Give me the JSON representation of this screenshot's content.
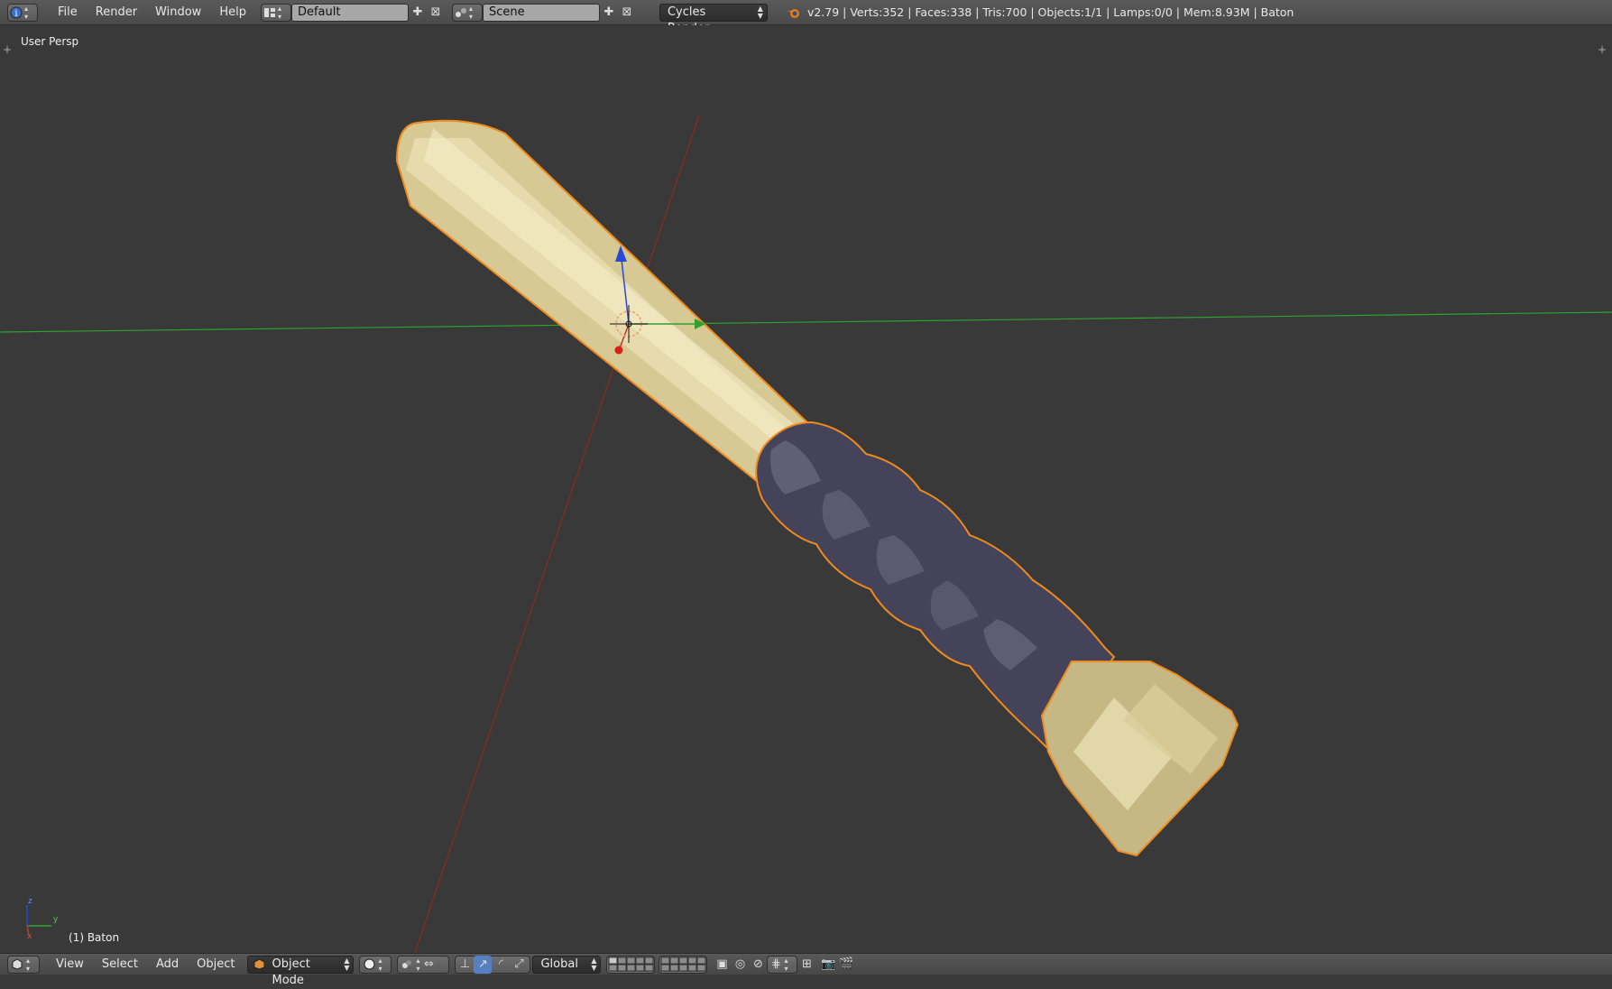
{
  "header": {
    "menu": [
      "File",
      "Render",
      "Window",
      "Help"
    ],
    "layout_name": "Default",
    "scene_name": "Scene",
    "render_engine": "Cycles Render",
    "stats": "v2.79 | Verts:352 | Faces:338 | Tris:700 | Objects:1/1 | Lamps:0/0 | Mem:8.93M | Baton"
  },
  "viewport": {
    "view_label": "User Persp",
    "object_label": "(1) Baton",
    "axis_labels": {
      "x": "x",
      "y": "y",
      "z": "z"
    }
  },
  "footer": {
    "menu": [
      "View",
      "Select",
      "Add",
      "Object"
    ],
    "mode": "Object Mode",
    "orientation": "Global"
  },
  "colors": {
    "background": "#393939",
    "selection_outline": "#f08a1c",
    "shaft": "#e2d6a6",
    "grip": "#4a4858",
    "axis_x": "#c0392b",
    "axis_y": "#2fa12f",
    "axis_z": "#2a48d8"
  }
}
